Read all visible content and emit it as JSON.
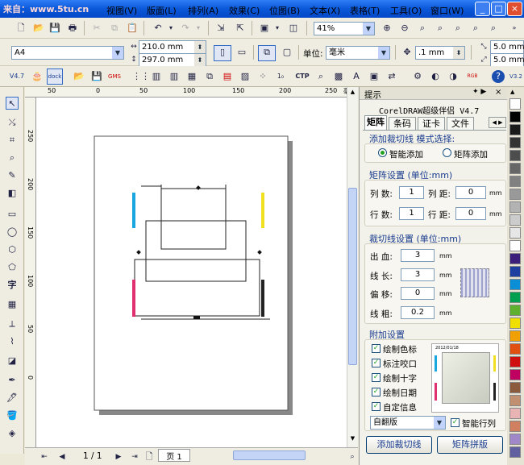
{
  "watermark": "来自：www.5tu.cn",
  "menu": [
    "视图(V)",
    "版面(L)",
    "排列(A)",
    "效果(C)",
    "位图(B)",
    "文本(X)",
    "表格(T)",
    "工具(O)",
    "窗口(W)"
  ],
  "window_buttons": [
    "_",
    "□",
    "×"
  ],
  "standard_bar": {
    "zoom": "41%"
  },
  "property_bar": {
    "paper": "A4",
    "width": "210.0 mm",
    "height": "297.0 mm",
    "unit_label": "单位:",
    "unit": "毫米",
    "nudge": ".1 mm",
    "dup_x": "5.0 mm",
    "dup_y": "5.0 mm"
  },
  "plugin_bar": {
    "version": "V4.7",
    "dock": "dock",
    "ctp": "CTP"
  },
  "rulers": {
    "unit": "毫米",
    "h_ticks": [
      "50",
      "0",
      "50",
      "100",
      "150",
      "200",
      "250"
    ],
    "v_ticks": [
      "250",
      "200",
      "150",
      "100",
      "50",
      "0"
    ]
  },
  "status": {
    "page_count": "1 / 1",
    "page_tab": "页 1"
  },
  "docker": {
    "header": "提示",
    "app_title": "CorelDRAW超级伴侣 V4.7",
    "tabs": [
      "矩阵",
      "条码",
      "证卡",
      "文件"
    ],
    "mode_title": "添加裁切线 模式选择:",
    "mode_options": [
      "智能添加",
      "矩阵添加"
    ],
    "matrix_title": "矩阵设置 (单位:mm)",
    "col_count_label": "列 数:",
    "col_count": "1",
    "col_gap_label": "列 距:",
    "col_gap": "0",
    "row_count_label": "行 数:",
    "row_count": "1",
    "row_gap_label": "行 距:",
    "row_gap": "0",
    "mm": "mm",
    "crop_title": "裁切线设置 (单位:mm)",
    "bleed_label": "出 血:",
    "bleed": "3",
    "length_label": "线 长:",
    "length": "3",
    "offset_label": "偏 移:",
    "offset": "0",
    "weight_label": "线 粗:",
    "weight": "0.2",
    "extra_title": "附加设置",
    "checks": [
      "绘制色标",
      "标注咬口",
      "绘制十字",
      "绘制日期",
      "自定信息"
    ],
    "preview_date": "2012/01/18",
    "template": "自翻版",
    "smart_rows": "智能行列",
    "btn_add": "添加裁切线",
    "btn_matrix": "矩阵拼版"
  },
  "palette_colors": [
    "#ffffff",
    "#000000",
    "#1a1a1a",
    "#333333",
    "#4d4d4d",
    "#666666",
    "#808080",
    "#999999",
    "#b3b3b3",
    "#cccccc",
    "#e6e6e6",
    "#ffffff",
    "#3c1f7a",
    "#1e3fa0",
    "#0a8fd6",
    "#00a050",
    "#60b030",
    "#f0e000",
    "#f0a000",
    "#e05010",
    "#d01010",
    "#c00060",
    "#8b5a3c",
    "#c09070",
    "#e8b4b4",
    "#d08060",
    "#a088c8",
    "#6060a0"
  ]
}
